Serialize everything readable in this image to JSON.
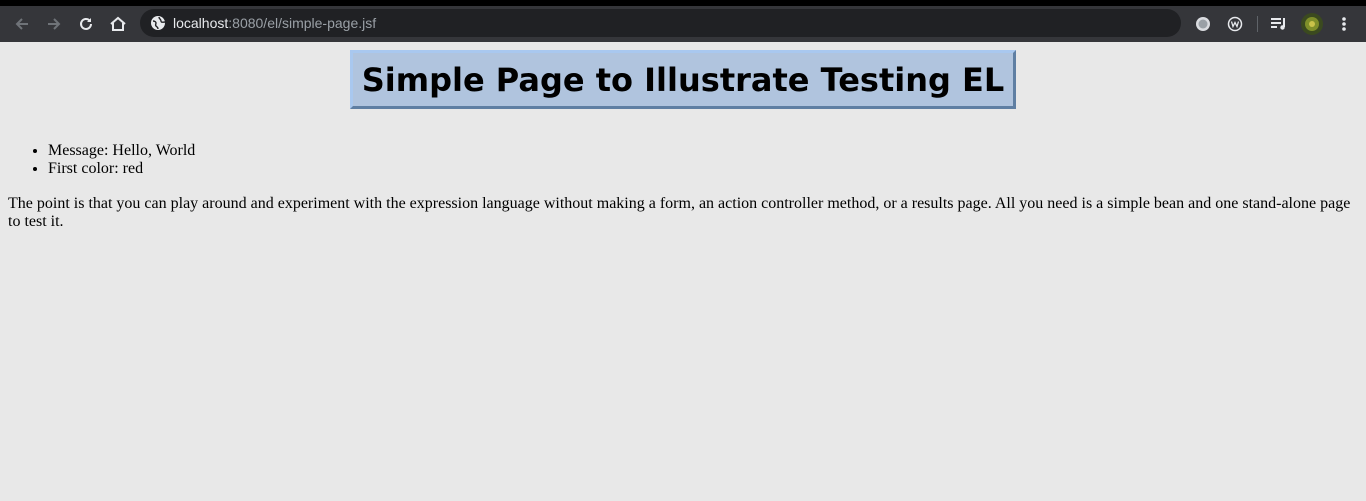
{
  "browser": {
    "url_host": "localhost",
    "url_path": ":8080/el/simple-page.jsf",
    "icons": {
      "back": "arrow-left-icon",
      "forward": "arrow-right-icon",
      "reload": "reload-icon",
      "home": "home-icon",
      "site_info": "globe-icon",
      "extension_1": "record-icon",
      "extension_2": "w-circle-icon",
      "media": "playlist-icon",
      "profile": "avatar",
      "menu": "kebab-menu-icon"
    }
  },
  "page": {
    "title": "Simple Page to Illustrate Testing EL",
    "facts": [
      "Message: Hello, World",
      "First color: red"
    ],
    "paragraph": "The point is that you can play around and experiment with the expression language without making a form, an action controller method, or a results page. All you need is a simple bean and one stand-alone page to test it."
  },
  "colors": {
    "page_background": "#e8e8e8",
    "title_background": "#b0c4de",
    "toolbar": "#35363a"
  }
}
